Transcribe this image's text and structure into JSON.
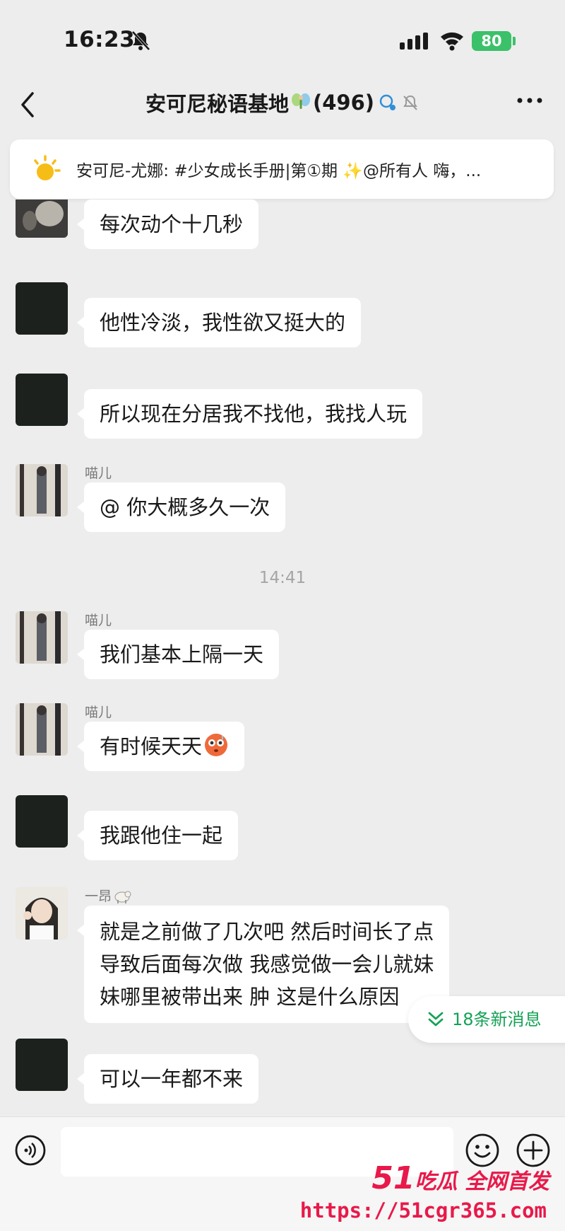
{
  "status_bar": {
    "time": "16:23",
    "battery": "80"
  },
  "header": {
    "group_name": "安可尼秘语基地",
    "member_count": "(496)"
  },
  "notice": {
    "text": "安可尼-尤娜: #少女成长手册|第①期 ✨@所有人 嗨，..."
  },
  "messages": [
    {
      "sender": "",
      "text": "每次动个十几秒"
    },
    {
      "sender": "",
      "text": "他性冷淡，我性欲又挺大的"
    },
    {
      "sender": "",
      "text": "所以现在分居我不找他，我找人玩"
    },
    {
      "sender": "喵儿",
      "text": "@ 你大概多久一次"
    },
    {
      "sender": "喵儿",
      "text": "我们基本上隔一天"
    },
    {
      "sender": "喵儿",
      "text": "有时候天天"
    },
    {
      "sender": "",
      "text": "我跟他住一起"
    },
    {
      "sender": "一昂",
      "line1": "就是之前做了几次吧 然后时间长了点",
      "line2": "导致后面每次做 我感觉做一会儿就妹",
      "line3": "妹哪里被带出来 肿 这是什么原因"
    },
    {
      "sender": "",
      "text": "可以一年都不来"
    }
  ],
  "timestamp": "14:41",
  "new_messages": "18条新消息",
  "watermark": {
    "brand_num": "51",
    "brand_text": "吃瓜 全网首发",
    "url": "https://51cgr365.com"
  },
  "colors": {
    "accent_green": "#15a256",
    "battery_green": "#3bc16a",
    "watermark_red": "#e8194a",
    "chat_bg": "#ededed"
  },
  "icons": [
    "bell-off-icon",
    "signal-icon",
    "wifi-icon",
    "back-icon",
    "fairy-icon",
    "group-icon",
    "mute-icon",
    "more-icon",
    "sun-icon",
    "flushed-emoji-icon",
    "goat-icon",
    "chevron-down-icon",
    "voice-icon",
    "smile-icon",
    "plus-icon"
  ]
}
